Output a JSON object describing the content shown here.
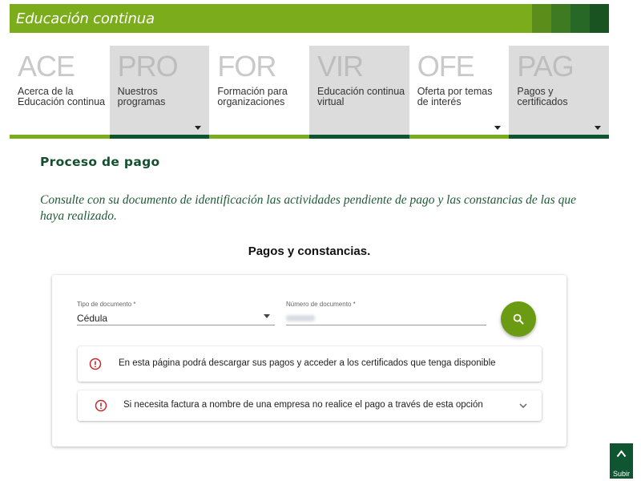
{
  "banner": {
    "title": "Educación continua",
    "block_colors": [
      "#7aac1c",
      "#5a8d1a",
      "#3e7a22",
      "#276827",
      "#1a5322"
    ]
  },
  "nav": {
    "items": [
      {
        "abbr": "ACE",
        "label": "Acerca de la Educación continua",
        "dropdown": false
      },
      {
        "abbr": "PRO",
        "label": "Nuestros programas",
        "dropdown": true
      },
      {
        "abbr": "FOR",
        "label": "Formación para organizaciones",
        "dropdown": false
      },
      {
        "abbr": "VIR",
        "label": "Educación continua virtual",
        "dropdown": false
      },
      {
        "abbr": "OFE",
        "label": "Oferta por temas de interés",
        "dropdown": true
      },
      {
        "abbr": "PAG",
        "label": "Pagos y certificados",
        "dropdown": true
      }
    ]
  },
  "page": {
    "title": "Proceso de pago",
    "intro": "Consulte con su documento de identificación las actividades pendiente de pago y las constancias de las que haya realizado.",
    "subtitle": "Pagos y constancias."
  },
  "form": {
    "doc_type_label": "Tipo de documento *",
    "doc_type_value": "Cédula",
    "doc_number_label": "Número de documento *",
    "search_icon": "search-icon"
  },
  "notices": [
    {
      "icon": "alert-circle-icon",
      "text": "En esta página podrá descargar sus pagos y acceder a los certificados que tenga disponible",
      "expandable": false
    },
    {
      "icon": "alert-circle-icon",
      "text": "Si necesita factura a nombre de una empresa no realice el pago a través de esta opción",
      "expandable": true
    }
  ],
  "scroll_top": {
    "label": "Subir",
    "icon": "chevron-up-icon"
  },
  "colors": {
    "brand_green": "#7aac1c",
    "dark_green": "#0f5532",
    "button_green": "#6b9b12",
    "alert_red": "#c62828"
  }
}
